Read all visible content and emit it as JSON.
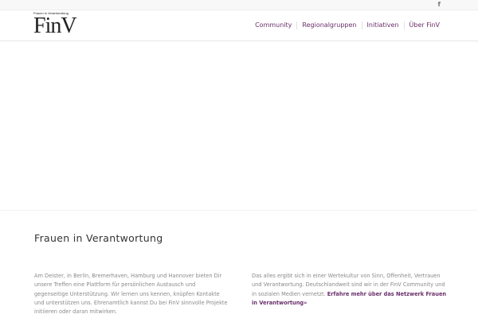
{
  "topbar": {
    "facebook_glyph": "f",
    "facebook_icon": "facebook-icon"
  },
  "logo": {
    "tagline": "Frauen in Verantwortung",
    "text": "FinV"
  },
  "nav": {
    "items": [
      {
        "label": "Community"
      },
      {
        "label": "Regionalgruppen"
      },
      {
        "label": "Initiativen"
      },
      {
        "label": "Über FinV"
      }
    ]
  },
  "main": {
    "title": "Frauen in Verantwortung",
    "left_paragraph": "Am Deister, in Berlin, Bremerhaven, Hamburg und Hannover bieten Dir unsere Treffen eine Plattform für persönlichen Austausch und gegenseitige Unterstützung. Wir lernen uns kennen, knüpfen Kontakte und unterstützen uns. Ehrenamtlich kannst Du bei FinV sinnvolle Projekte initiieren oder daran mitwirken.",
    "right_paragraph": "Das alles ergibt sich in einer Wertekultur von Sinn, Offenheit, Vertrauen und Verantwortung. Deutschlandweit sind wir in der FinV Community und in sozialen Medien vernetzt.",
    "right_link": "Erfahre mehr über das Netzwerk Frauen in Verantwortung»"
  },
  "colors": {
    "accent": "#6a2f6a",
    "text": "#8a8a8a",
    "title": "#333333"
  }
}
